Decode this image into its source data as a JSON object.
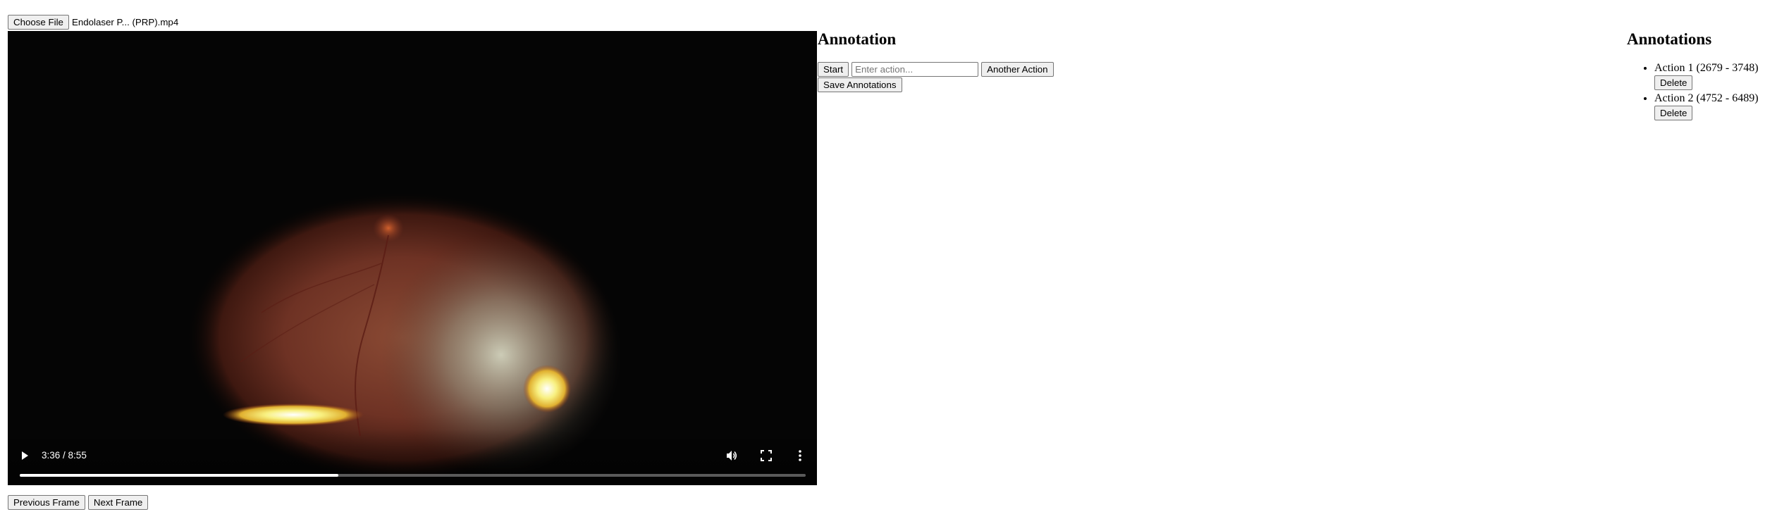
{
  "file_input": {
    "button_label": "Choose File",
    "file_name": "Endolaser P... (PRP).mp4"
  },
  "video": {
    "current_time": "3:36",
    "separator": " / ",
    "duration": "8:55",
    "progress_fraction": 0.405,
    "icons": {
      "play": "play-icon",
      "volume": "volume-icon",
      "fullscreen": "fullscreen-icon",
      "more": "more-options-icon"
    }
  },
  "frame_controls": {
    "previous_label": "Previous Frame",
    "next_label": "Next Frame"
  },
  "annotation": {
    "heading": "Annotation",
    "start_label": "Start",
    "action_placeholder": "Enter action...",
    "another_action_label": "Another Action",
    "save_label": "Save Annotations"
  },
  "annotations_list": {
    "heading": "Annotations",
    "delete_label": "Delete",
    "items": [
      {
        "name": "Action 1",
        "range": " (2679 - 3748)"
      },
      {
        "name": "Action 2",
        "range": " (4752 - 6489)"
      }
    ]
  }
}
